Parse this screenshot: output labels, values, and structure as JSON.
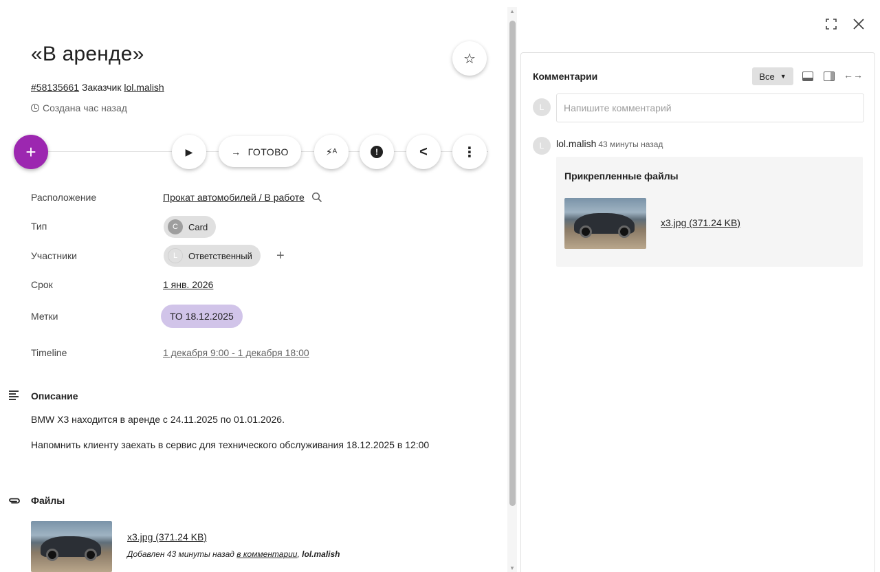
{
  "header": {
    "title": "«В аренде»",
    "id_link": "#58135661",
    "customer_label": "Заказчик",
    "customer_link": "lol.malish",
    "created": "Создана час назад"
  },
  "toolbar": {
    "add_label": "+",
    "play_label": "▶",
    "done_label": "ГОТОВО",
    "done_arrow": "→",
    "flash_label": "⚡ᴬ",
    "alert_label": "!",
    "share_label": "<",
    "more_label": "⋮",
    "star_label": "☆"
  },
  "properties": {
    "location": {
      "label": "Расположение",
      "value": "Прокат автомобилей / В работе"
    },
    "type": {
      "label": "Тип",
      "value": "Card",
      "avatar": "C"
    },
    "participants": {
      "label": "Участники",
      "value": "Ответственный",
      "avatar": "L",
      "add": "+"
    },
    "deadline": {
      "label": "Срок",
      "value": "1 янв. 2026"
    },
    "tags": {
      "label": "Метки",
      "value": "ТО 18.12.2025"
    },
    "timeline": {
      "label": "Timeline",
      "value": "1 декабря 9:00 - 1 декабря 18:00"
    }
  },
  "description": {
    "title": "Описание",
    "lines": [
      "BMW X3 находится в аренде с 24.11.2025 по 01.01.2026.",
      "Напомнить клиенту заехать в сервис для технического обслуживания 18.12.2025 в 12:00"
    ]
  },
  "files": {
    "title": "Файлы",
    "name": "x3.jpg (371.24 KB)",
    "meta_prefix": "Добавлен 43 минуты назад",
    "meta_link": "в комментарии",
    "meta_author": "lol.malish"
  },
  "comments": {
    "title": "Комментарии",
    "filter": "Все",
    "placeholder": "Напишите комментарий",
    "avatar": "L",
    "author": "lol.malish",
    "time": "43 минуты назад",
    "attached_title": "Прикрепленные файлы",
    "attached_file": "x3.jpg (371.24 KB)"
  },
  "window": {
    "expand_icon": "⛶",
    "close_icon": "✕"
  },
  "colors": {
    "fab": "#9c27b0",
    "tag_chip": "#d1c4e9",
    "chip": "#e0e0e0"
  }
}
